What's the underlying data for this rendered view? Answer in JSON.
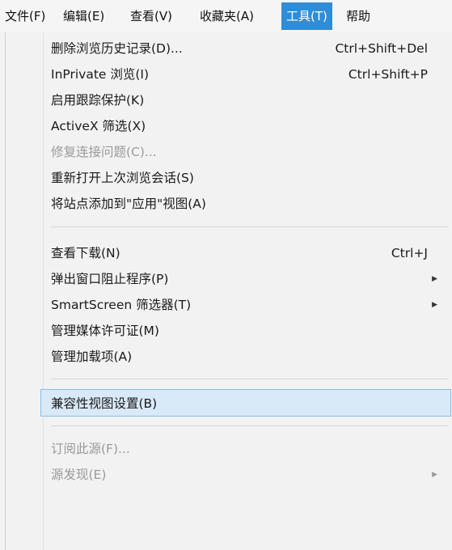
{
  "menubar": {
    "items": [
      {
        "label": "文件(F)",
        "active": false
      },
      {
        "label": "编辑(E)",
        "active": false
      },
      {
        "label": "查看(V)",
        "active": false
      },
      {
        "label": "收藏夹(A)",
        "active": false
      },
      {
        "label": "工具(T)",
        "active": true
      },
      {
        "label": "帮助",
        "active": false
      }
    ]
  },
  "menu": {
    "items": [
      {
        "label": "删除浏览历史记录(D)...",
        "shortcut": "Ctrl+Shift+Del"
      },
      {
        "label": "InPrivate 浏览(I)",
        "shortcut": "Ctrl+Shift+P"
      },
      {
        "label": "启用跟踪保护(K)"
      },
      {
        "label": "ActiveX 筛选(X)"
      },
      {
        "label": "修复连接问题(C)...",
        "disabled": true
      },
      {
        "label": "重新打开上次浏览会话(S)"
      },
      {
        "label": "将站点添加到\"应用\"视图(A)"
      },
      {
        "label": "查看下载(N)",
        "shortcut": "Ctrl+J"
      },
      {
        "label": "弹出窗口阻止程序(P)",
        "submenu": true
      },
      {
        "label": "SmartScreen 筛选器(T)",
        "submenu": true
      },
      {
        "label": "管理媒体许可证(M)"
      },
      {
        "label": "管理加载项(A)"
      },
      {
        "label": "兼容性视图设置(B)",
        "highlighted": true
      },
      {
        "label": "订阅此源(F)...",
        "disabled": true
      },
      {
        "label": "源发现(E)",
        "disabled": true,
        "submenu": true
      }
    ]
  },
  "colors": {
    "active_menu_bg": "#2f8dd8",
    "highlight_bg": "#d9e9f8",
    "highlight_border": "#8bbbe6",
    "disabled_text": "#9a9a9a"
  }
}
